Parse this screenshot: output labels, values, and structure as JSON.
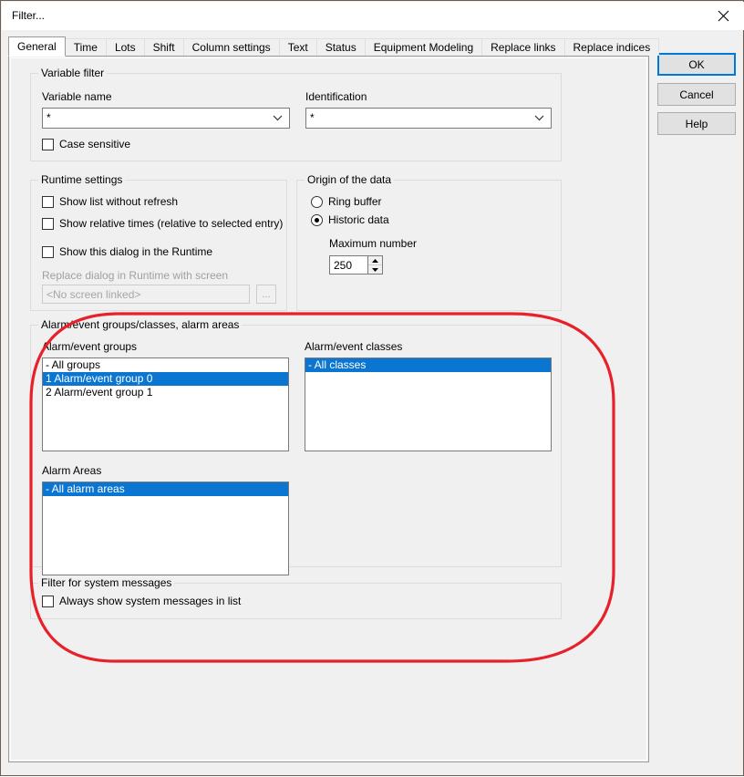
{
  "window": {
    "title": "Filter...",
    "close_icon": "close-icon"
  },
  "tabs": [
    {
      "label": "General",
      "active": true
    },
    {
      "label": "Time",
      "active": false
    },
    {
      "label": "Lots",
      "active": false
    },
    {
      "label": "Shift",
      "active": false
    },
    {
      "label": "Column settings",
      "active": false
    },
    {
      "label": "Text",
      "active": false
    },
    {
      "label": "Status",
      "active": false
    },
    {
      "label": "Equipment Modeling",
      "active": false
    },
    {
      "label": "Replace links",
      "active": false
    },
    {
      "label": "Replace indices",
      "active": false
    }
  ],
  "buttons": {
    "ok": "OK",
    "cancel": "Cancel",
    "help": "Help"
  },
  "variable_filter": {
    "title": "Variable filter",
    "variable_name_label": "Variable name",
    "variable_name_value": "*",
    "identification_label": "Identification",
    "identification_value": "*",
    "case_sensitive_label": "Case sensitive",
    "case_sensitive_checked": false
  },
  "runtime_settings": {
    "title": "Runtime settings",
    "show_list_without_refresh_label": "Show list without refresh",
    "show_relative_times_label": "Show relative times (relative to selected entry)",
    "show_dialog_runtime_label": "Show this dialog in the Runtime",
    "replace_dialog_label": "Replace dialog in Runtime with screen",
    "replace_dialog_value": "<No screen linked>",
    "browse_button_label": "..."
  },
  "origin_of_data": {
    "title": "Origin of the data",
    "ring_buffer_label": "Ring buffer",
    "historic_data_label": "Historic data",
    "selected": "historic_data",
    "maximum_number_label": "Maximum number",
    "maximum_number_value": "250"
  },
  "alarm_section": {
    "title": "Alarm/event groups/classes, alarm areas",
    "groups_label": "Alarm/event groups",
    "groups_items": [
      {
        "text": "- All groups",
        "selected": false
      },
      {
        "text": "1 Alarm/event group 0",
        "selected": true
      },
      {
        "text": "2 Alarm/event group 1",
        "selected": false
      }
    ],
    "classes_label": "Alarm/event classes",
    "classes_items": [
      {
        "text": "- All classes",
        "selected": true
      }
    ],
    "areas_label": "Alarm Areas",
    "areas_items": [
      {
        "text": "- All alarm areas",
        "selected": true
      }
    ]
  },
  "system_messages": {
    "title": "Filter for system messages",
    "always_show_label": "Always show system messages in list",
    "always_show_checked": false
  },
  "colors": {
    "selection_blue": "#0b76d1",
    "focus_blue": "#0078d7",
    "annotation_red": "#e8202a",
    "dialog_face": "#f0f0f0"
  }
}
